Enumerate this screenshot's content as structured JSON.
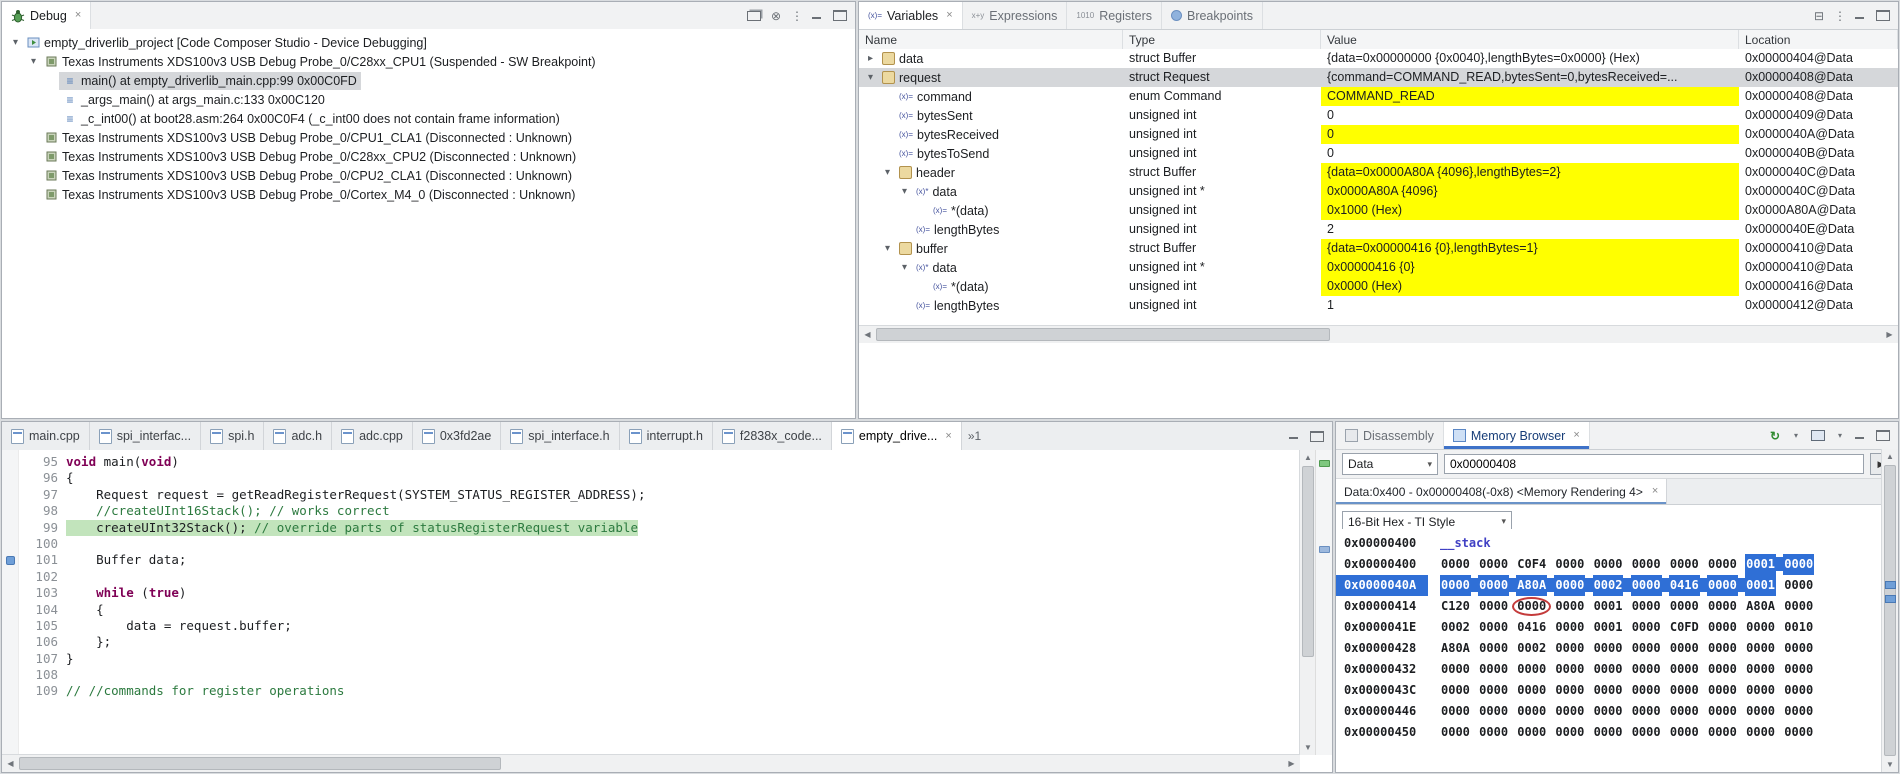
{
  "icons": {
    "close": "×",
    "expanded": "▾",
    "collapsed": "▸",
    "scalar_glyph": "(x)=",
    "pointer_glyph": "(x)*",
    "refresh": "↻",
    "dropdown_caret": "▾",
    "menu_dots": "⋮",
    "disconnect": "⊗",
    "collapse_all": "⊟",
    "go": "▶"
  },
  "debug": {
    "tab_label": "Debug",
    "tree": [
      {
        "level": 0,
        "expand": "down",
        "icon": "launch",
        "text": "empty_driverlib_project [Code Composer Studio - Device Debugging]"
      },
      {
        "level": 1,
        "expand": "down",
        "icon": "chip",
        "text": "Texas Instruments XDS100v3 USB Debug Probe_0/C28xx_CPU1 (Suspended - SW Breakpoint)"
      },
      {
        "level": 2,
        "expand": null,
        "icon": "frame",
        "text": "main() at empty_driverlib_main.cpp:99 0x00C0FD",
        "selected": true
      },
      {
        "level": 2,
        "expand": null,
        "icon": "frame",
        "text": "_args_main() at args_main.c:133 0x00C120"
      },
      {
        "level": 2,
        "expand": null,
        "icon": "frame",
        "text": "_c_int00() at boot28.asm:264 0x00C0F4 (_c_int00 does not contain frame information)"
      },
      {
        "level": 1,
        "expand": null,
        "icon": "chip",
        "text": "Texas Instruments XDS100v3 USB Debug Probe_0/CPU1_CLA1 (Disconnected : Unknown)"
      },
      {
        "level": 1,
        "expand": null,
        "icon": "chip",
        "text": "Texas Instruments XDS100v3 USB Debug Probe_0/C28xx_CPU2 (Disconnected : Unknown)"
      },
      {
        "level": 1,
        "expand": null,
        "icon": "chip",
        "text": "Texas Instruments XDS100v3 USB Debug Probe_0/CPU2_CLA1 (Disconnected : Unknown)"
      },
      {
        "level": 1,
        "expand": null,
        "icon": "chip",
        "text": "Texas Instruments XDS100v3 USB Debug Probe_0/Cortex_M4_0 (Disconnected : Unknown)"
      }
    ]
  },
  "variables": {
    "tabs": [
      {
        "label": "Variables",
        "active": true
      },
      {
        "label": "Expressions",
        "active": false
      },
      {
        "label": "Registers",
        "active": false
      },
      {
        "label": "Breakpoints",
        "active": false
      }
    ],
    "columns": [
      "Name",
      "Type",
      "Value",
      "Location"
    ],
    "rows": [
      {
        "level": 0,
        "expand": "right",
        "icon": "struct",
        "name": "data",
        "type": "struct Buffer",
        "value": "{data=0x00000000 {0x0040},lengthBytes=0x0000} (Hex)",
        "loc": "0x00000404@Data",
        "yellow": false,
        "selected": false
      },
      {
        "level": 0,
        "expand": "down",
        "icon": "struct",
        "name": "request",
        "type": "struct Request",
        "value": "{command=COMMAND_READ,bytesSent=0,bytesReceived=...",
        "loc": "0x00000408@Data",
        "yellow": false,
        "selected": true
      },
      {
        "level": 1,
        "expand": null,
        "icon": "scalar",
        "name": "command",
        "type": "enum Command",
        "value": "COMMAND_READ",
        "loc": "0x00000408@Data",
        "yellow": true
      },
      {
        "level": 1,
        "expand": null,
        "icon": "scalar",
        "name": "bytesSent",
        "type": "unsigned int",
        "value": "0",
        "loc": "0x00000409@Data",
        "yellow": false
      },
      {
        "level": 1,
        "expand": null,
        "icon": "scalar",
        "name": "bytesReceived",
        "type": "unsigned int",
        "value": "0",
        "loc": "0x0000040A@Data",
        "yellow": true
      },
      {
        "level": 1,
        "expand": null,
        "icon": "scalar",
        "name": "bytesToSend",
        "type": "unsigned int",
        "value": "0",
        "loc": "0x0000040B@Data",
        "yellow": false
      },
      {
        "level": 1,
        "expand": "down",
        "icon": "struct",
        "name": "header",
        "type": "struct Buffer",
        "value": "{data=0x0000A80A {4096},lengthBytes=2}",
        "loc": "0x0000040C@Data",
        "yellow": true
      },
      {
        "level": 2,
        "expand": "down",
        "icon": "pointer",
        "name": "data",
        "type": "unsigned int *",
        "value": "0x0000A80A {4096}",
        "loc": "0x0000040C@Data",
        "yellow": true
      },
      {
        "level": 3,
        "expand": null,
        "icon": "scalar",
        "name": "*(data)",
        "type": "unsigned int",
        "value": "0x1000 (Hex)",
        "loc": "0x0000A80A@Data",
        "yellow": true
      },
      {
        "level": 2,
        "expand": null,
        "icon": "scalar",
        "name": "lengthBytes",
        "type": "unsigned int",
        "value": "2",
        "loc": "0x0000040E@Data",
        "yellow": false
      },
      {
        "level": 1,
        "expand": "down",
        "icon": "struct",
        "name": "buffer",
        "type": "struct Buffer",
        "value": "{data=0x00000416 {0},lengthBytes=1}",
        "loc": "0x00000410@Data",
        "yellow": true
      },
      {
        "level": 2,
        "expand": "down",
        "icon": "pointer",
        "name": "data",
        "type": "unsigned int *",
        "value": "0x00000416 {0}",
        "loc": "0x00000410@Data",
        "yellow": true
      },
      {
        "level": 3,
        "expand": null,
        "icon": "scalar",
        "name": "*(data)",
        "type": "unsigned int",
        "value": "0x0000 (Hex)",
        "loc": "0x00000416@Data",
        "yellow": true
      },
      {
        "level": 2,
        "expand": null,
        "icon": "scalar",
        "name": "lengthBytes",
        "type": "unsigned int",
        "value": "1",
        "loc": "0x00000412@Data",
        "yellow": false
      }
    ]
  },
  "editor": {
    "tabs": [
      {
        "label": "main.cpp",
        "active": false
      },
      {
        "label": "spi_interfac...",
        "active": false
      },
      {
        "label": "spi.h",
        "active": false
      },
      {
        "label": "adc.h",
        "active": false
      },
      {
        "label": "adc.cpp",
        "active": false
      },
      {
        "label": "0x3fd2ae",
        "active": false
      },
      {
        "label": "spi_interface.h",
        "active": false
      },
      {
        "label": "interrupt.h",
        "active": false
      },
      {
        "label": "f2838x_code...",
        "active": false
      },
      {
        "label": "empty_drive...",
        "active": true
      }
    ],
    "overflow_indicator": "»1",
    "lines": [
      {
        "no": 95,
        "tokens": [
          {
            "t": "void",
            "s": "k"
          },
          {
            "t": " main(",
            "s": "p"
          },
          {
            "t": "void",
            "s": "k"
          },
          {
            "t": ")",
            "s": "p"
          }
        ]
      },
      {
        "no": 96,
        "tokens": [
          {
            "t": "{",
            "s": "p"
          }
        ]
      },
      {
        "no": 97,
        "tokens": [
          {
            "t": "    Request request = getReadRegisterRequest(SYSTEM_STATUS_REGISTER_ADDRESS);",
            "s": "p"
          }
        ]
      },
      {
        "no": 98,
        "tokens": [
          {
            "t": "    ",
            "s": "p"
          },
          {
            "t": "//createUInt16Stack(); // works correct",
            "s": "c"
          }
        ]
      },
      {
        "no": 99,
        "current": true,
        "tokens": [
          {
            "t": "    createUInt32Stack(); ",
            "s": "p"
          },
          {
            "t": "// override parts of statusRegisterRequest variable",
            "s": "c"
          }
        ]
      },
      {
        "no": 100,
        "tokens": []
      },
      {
        "no": 101,
        "marker": true,
        "tokens": [
          {
            "t": "    Buffer data;",
            "s": "p"
          }
        ]
      },
      {
        "no": 102,
        "tokens": []
      },
      {
        "no": 103,
        "tokens": [
          {
            "t": "    ",
            "s": "p"
          },
          {
            "t": "while",
            "s": "k"
          },
          {
            "t": " (",
            "s": "p"
          },
          {
            "t": "true",
            "s": "k"
          },
          {
            "t": ")",
            "s": "p"
          }
        ]
      },
      {
        "no": 104,
        "tokens": [
          {
            "t": "    {",
            "s": "p"
          }
        ]
      },
      {
        "no": 105,
        "tokens": [
          {
            "t": "        data = request.buffer;",
            "s": "p"
          }
        ]
      },
      {
        "no": 106,
        "tokens": [
          {
            "t": "    };",
            "s": "p"
          }
        ]
      },
      {
        "no": 107,
        "tokens": [
          {
            "t": "}",
            "s": "p"
          }
        ]
      },
      {
        "no": 108,
        "tokens": []
      },
      {
        "no": 109,
        "tokens": [
          {
            "t": "// //commands for register operations",
            "s": "c"
          }
        ]
      }
    ]
  },
  "memory": {
    "tabs": [
      {
        "label": "Disassembly",
        "active": false
      },
      {
        "label": "Memory Browser",
        "active": true
      }
    ],
    "space_selector": "Data",
    "address_value": "0x00000408",
    "rendering_tab_label": "Data:0x400 - 0x00000408(-0x8) <Memory Rendering 4>",
    "format_selector": "16-Bit Hex - TI Style",
    "rows": [
      {
        "addr": "0x00000400",
        "label": "__stack"
      },
      {
        "addr": "0x00000400",
        "groups": [
          "0000",
          "0000",
          "C0F4",
          "0000",
          "0000",
          "0000",
          "0000",
          "0000",
          "0001",
          "0000"
        ],
        "sel": [
          8,
          9
        ]
      },
      {
        "addr": "0x0000040A",
        "addr_selected": true,
        "groups": [
          "0000",
          "0000",
          "A80A",
          "0000",
          "0002",
          "0000",
          "0416",
          "0000",
          "0001",
          "0000"
        ],
        "sel": [
          0,
          1,
          2,
          3,
          4,
          5,
          6,
          7,
          8
        ]
      },
      {
        "addr": "0x00000414",
        "groups": [
          "C120",
          "0000",
          "0000",
          "0000",
          "0001",
          "0000",
          "0000",
          "0000",
          "A80A",
          "0000"
        ],
        "circled": [
          2
        ]
      },
      {
        "addr": "0x0000041E",
        "groups": [
          "0002",
          "0000",
          "0416",
          "0000",
          "0001",
          "0000",
          "C0FD",
          "0000",
          "0000",
          "0010"
        ]
      },
      {
        "addr": "0x00000428",
        "groups": [
          "A80A",
          "0000",
          "0002",
          "0000",
          "0000",
          "0000",
          "0000",
          "0000",
          "0000",
          "0000"
        ]
      },
      {
        "addr": "0x00000432",
        "groups": [
          "0000",
          "0000",
          "0000",
          "0000",
          "0000",
          "0000",
          "0000",
          "0000",
          "0000",
          "0000"
        ]
      },
      {
        "addr": "0x0000043C",
        "groups": [
          "0000",
          "0000",
          "0000",
          "0000",
          "0000",
          "0000",
          "0000",
          "0000",
          "0000",
          "0000"
        ]
      },
      {
        "addr": "0x00000446",
        "groups": [
          "0000",
          "0000",
          "0000",
          "0000",
          "0000",
          "0000",
          "0000",
          "0000",
          "0000",
          "0000"
        ]
      },
      {
        "addr": "0x00000450",
        "groups": [
          "0000",
          "0000",
          "0000",
          "0000",
          "0000",
          "0000",
          "0000",
          "0000",
          "0000",
          "0000"
        ]
      }
    ]
  }
}
